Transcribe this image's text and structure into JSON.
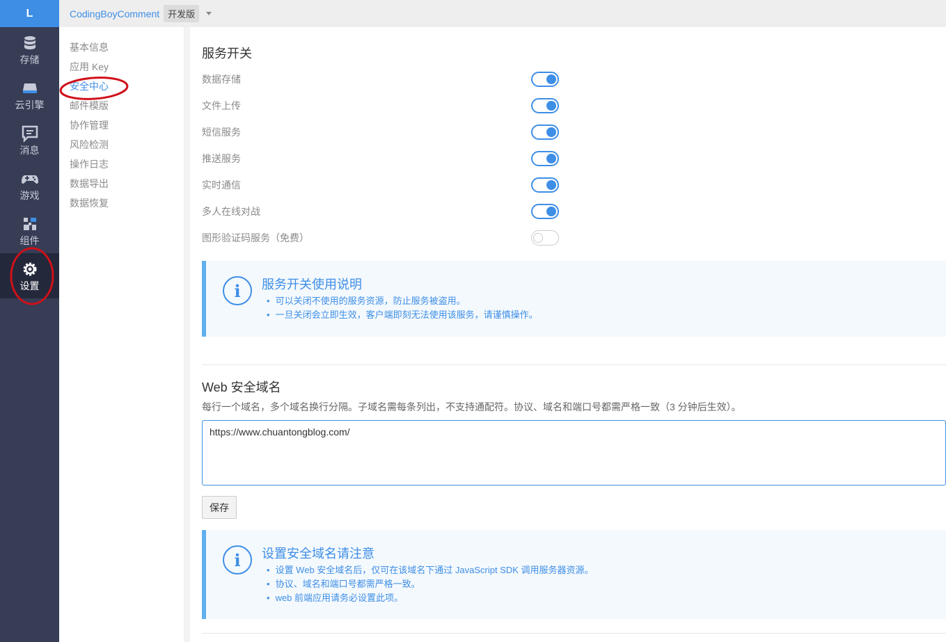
{
  "sidebar": {
    "logo": "L",
    "items": [
      {
        "label": "存储",
        "icon": "database-icon"
      },
      {
        "label": "云引擎",
        "icon": "cloud-engine-icon"
      },
      {
        "label": "消息",
        "icon": "message-icon"
      },
      {
        "label": "游戏",
        "icon": "gamepad-icon"
      },
      {
        "label": "组件",
        "icon": "components-icon"
      },
      {
        "label": "设置",
        "icon": "gear-icon",
        "active": true
      }
    ]
  },
  "topbar": {
    "app_name": "CodingBoyComment",
    "env": "开发版"
  },
  "subnav": {
    "items": [
      "基本信息",
      "应用 Key",
      "安全中心",
      "邮件模版",
      "协作管理",
      "风险检测",
      "操作日志",
      "数据导出",
      "数据恢复"
    ],
    "active": "安全中心"
  },
  "services": {
    "title": "服务开关",
    "switches": [
      {
        "label": "数据存储",
        "on": true
      },
      {
        "label": "文件上传",
        "on": true
      },
      {
        "label": "短信服务",
        "on": true
      },
      {
        "label": "推送服务",
        "on": true
      },
      {
        "label": "实时通信",
        "on": true
      },
      {
        "label": "多人在线对战",
        "on": true
      },
      {
        "label": "图形验证码服务（免费）",
        "on": false
      }
    ],
    "notice": {
      "title": "服务开关使用说明",
      "items": [
        "可以关闭不使用的服务资源，防止服务被盗用。",
        "一旦关闭会立即生效，客户端即刻无法使用该服务，请谨慎操作。"
      ]
    }
  },
  "web_domain": {
    "title": "Web 安全域名",
    "description": "每行一个域名，多个域名换行分隔。子域名需每条列出，不支持通配符。协议、域名和端口号都需严格一致（3 分钟后生效）。",
    "value": "https://www.chuantongblog.com/",
    "save_label": "保存",
    "notice": {
      "title": "设置安全域名请注意",
      "items": [
        "设置 Web 安全域名后，仅可在该域名下通过 JavaScript SDK 调用服务器资源。",
        "协议、域名和端口号都需严格一致。",
        "web 前端应用请务必设置此项。"
      ]
    }
  },
  "colors": {
    "accent": "#3e8ee6",
    "sidebar": "#373d55",
    "annotation": "#d0101a"
  }
}
